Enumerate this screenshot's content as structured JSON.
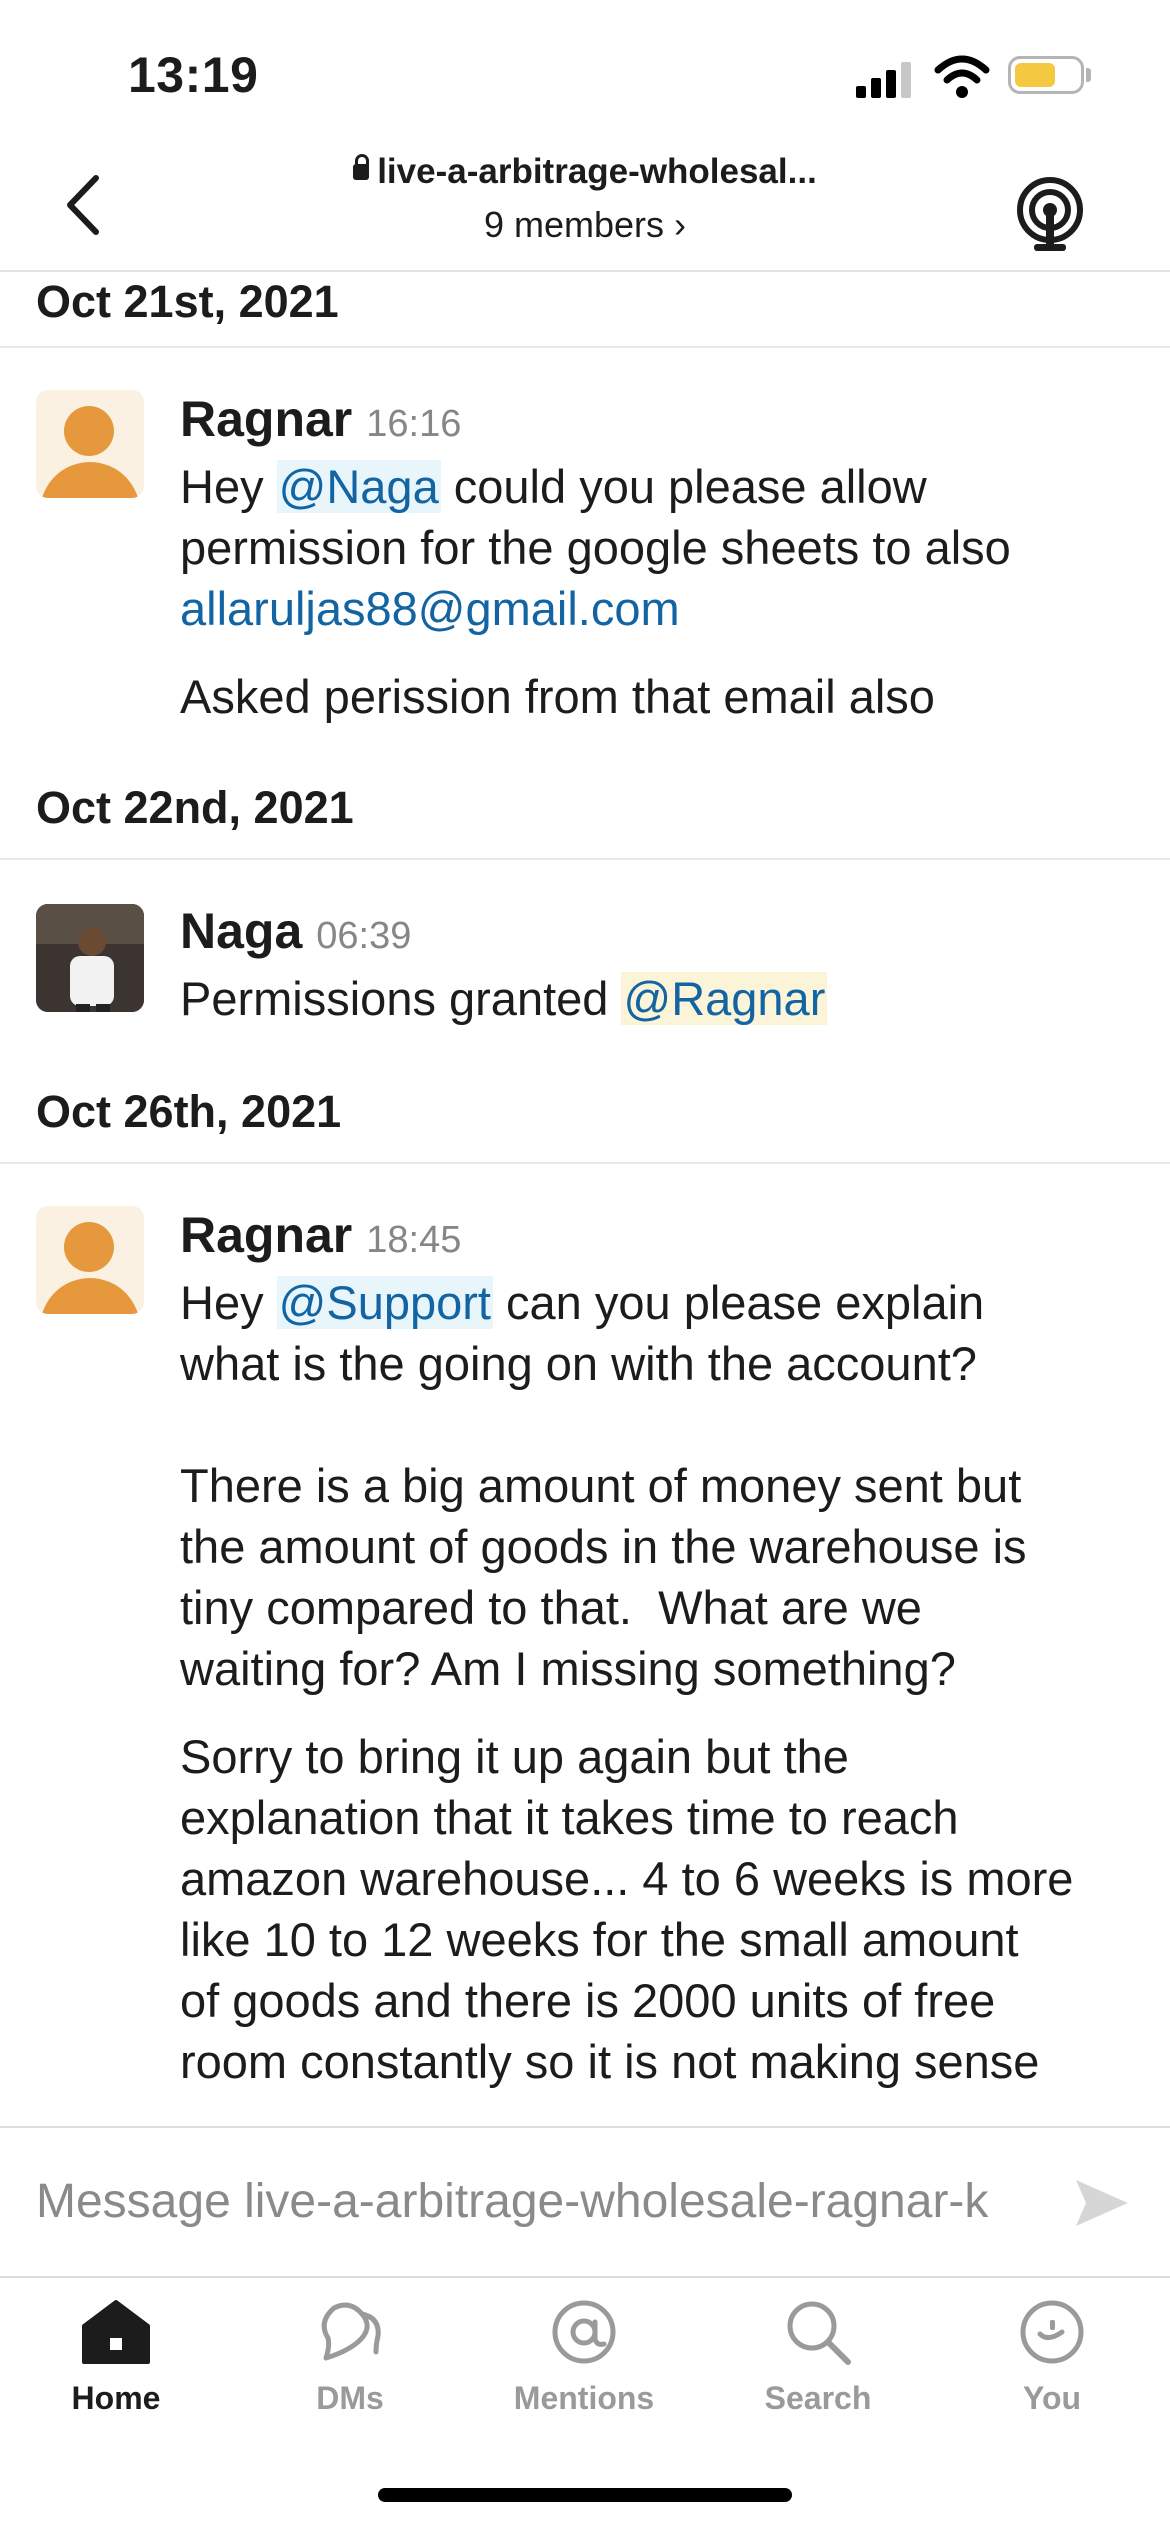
{
  "status_bar": {
    "time": "13:19"
  },
  "header": {
    "channel_name": "live-a-arbitrage-wholesal...",
    "members": "9 members"
  },
  "messages": [
    {
      "date": "Oct 21st, 2021",
      "sender": "Ragnar",
      "time": "16:16",
      "line1_a": "Hey ",
      "mention": "@Naga",
      "line1_b": " could you please allow\npermission for the google sheets to also\n",
      "email": "allaruljas88@gmail.com",
      "followup": "Asked perission from that email also"
    },
    {
      "date": "Oct 22nd, 2021",
      "sender": "Naga",
      "time": "06:39",
      "text": "Permissions granted ",
      "mention": "@Ragnar"
    },
    {
      "date": "Oct 26th, 2021",
      "sender": "Ragnar",
      "time": "18:45",
      "line1_a": "Hey ",
      "mention": "@Support",
      "line1_b": " can you please explain\nwhat is the going on with the account?\n\nThere is a big amount of money sent but\nthe amount of goods in the warehouse is\ntiny compared to that.  What are we\nwaiting for? Am I missing something?",
      "followup": "Sorry to bring it up again but the\nexplanation that it takes time to reach\namazon warehouse... 4 to 6 weeks is more\nlike 10 to 12 weeks for the small amount\nof goods and there is 2000 units of free\nroom constantly so it is not making sense"
    }
  ],
  "composer": {
    "placeholder": "Message live-a-arbitrage-wholesale-ragnar-k"
  },
  "tabs": [
    {
      "label": "Home",
      "icon": "home-icon"
    },
    {
      "label": "DMs",
      "icon": "dms-icon"
    },
    {
      "label": "Mentions",
      "icon": "mentions-icon"
    },
    {
      "label": "Search",
      "icon": "search-icon"
    },
    {
      "label": "You",
      "icon": "you-icon"
    }
  ],
  "colors": {
    "link": "#1264a3",
    "mention_bg": "#e8f5fa",
    "self_mention_bg": "#fcf4d9",
    "avatar_orange": "#e5993c",
    "battery_yellow": "#f5c842"
  }
}
